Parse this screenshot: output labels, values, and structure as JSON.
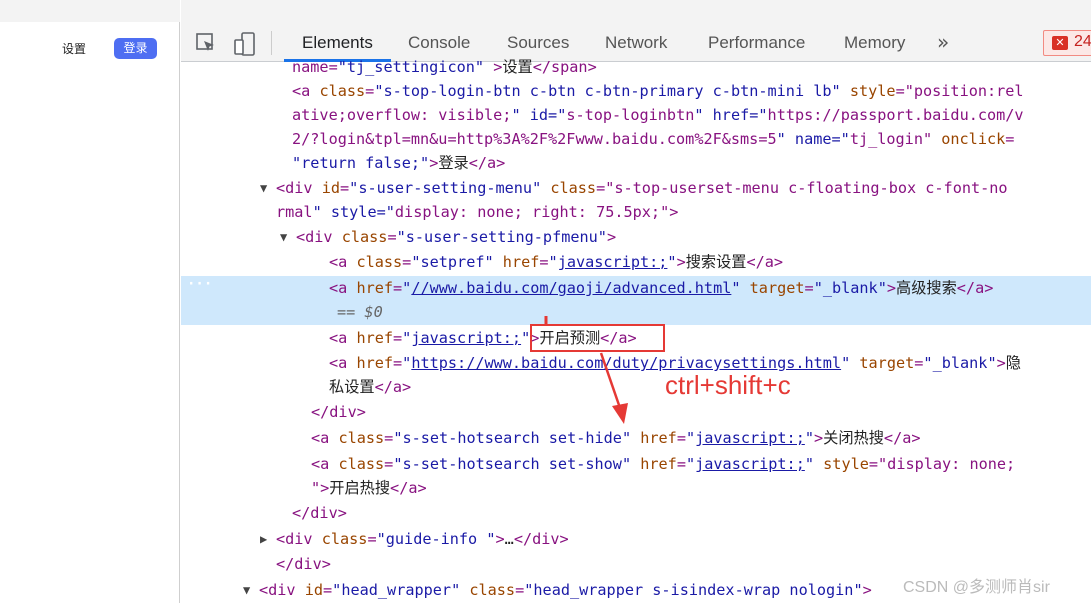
{
  "page": {
    "settings_label": "设置",
    "login_label": "登录"
  },
  "devtools": {
    "tabs": [
      "Elements",
      "Console",
      "Sources",
      "Network",
      "Performance",
      "Memory"
    ],
    "more_tabs": "»",
    "error_count": "24"
  },
  "tree_lines": [
    {
      "t": "name=\"tj_settingicon\" >设置</span>"
    },
    {
      "t": "<a class=\"s-top-login-btn c-btn c-btn-primary c-btn-mini lb\" style=\"position:rel"
    },
    {
      "t": "ative;overflow: visible;\" id=\"s-top-loginbtn\" href=\"https://passport.baidu.com/v"
    },
    {
      "t": "2/?login&tpl=mn&u=http%3A%2F%2Fwww.baidu.com%2F&sms=5\" name=\"tj_login\" onclick="
    },
    {
      "t": "\"return false;\">登录</a>"
    },
    {
      "t": "<div id=\"s-user-setting-menu\" class=\"s-top-userset-menu c-floating-box c-font-no"
    },
    {
      "t": "rmal\" style=\"display: none; right: 75.5px;\">"
    },
    {
      "t": "<div class=\"s-user-setting-pfmenu\">"
    },
    {
      "t": "<a class=\"setpref\" href=\"javascript:;\">搜索设置</a>"
    },
    {
      "t": "<a href=\"//www.baidu.com/gaoji/advanced.html\" target=\"_blank\">高级搜索</a>"
    },
    {
      "t": "== $0"
    },
    {
      "t": "<a href=\"javascript:;\">开启预测</a>"
    },
    {
      "t": "<a href=\"https://www.baidu.com/duty/privacysettings.html\" target=\"_blank\">隐"
    },
    {
      "t": "私设置</a>"
    },
    {
      "t": "</div>"
    },
    {
      "t": "<a class=\"s-set-hotsearch set-hide\" href=\"javascript:;\">关闭热搜</a>"
    },
    {
      "t": "<a class=\"s-set-hotsearch set-show\" href=\"javascript:;\" style=\"display: none;"
    },
    {
      "t": "\">开启热搜</a>"
    },
    {
      "t": "</div>"
    },
    {
      "t": "<div class=\"guide-info \">…</div>"
    },
    {
      "t": "</div>"
    },
    {
      "t": "<div id=\"head_wrapper\" class=\"head_wrapper s-isindex-wrap nologin\">"
    }
  ],
  "annotation": {
    "shortcut": "ctrl+shift+c",
    "watermark": "CSDN @多测师肖sir"
  },
  "colors": {
    "tag": "#881280",
    "attr": "#994500",
    "value": "#1a1aa6",
    "selected_row": "#cfe8fc",
    "annotation_red": "#e53935",
    "login_blue": "#4e6ef2"
  }
}
